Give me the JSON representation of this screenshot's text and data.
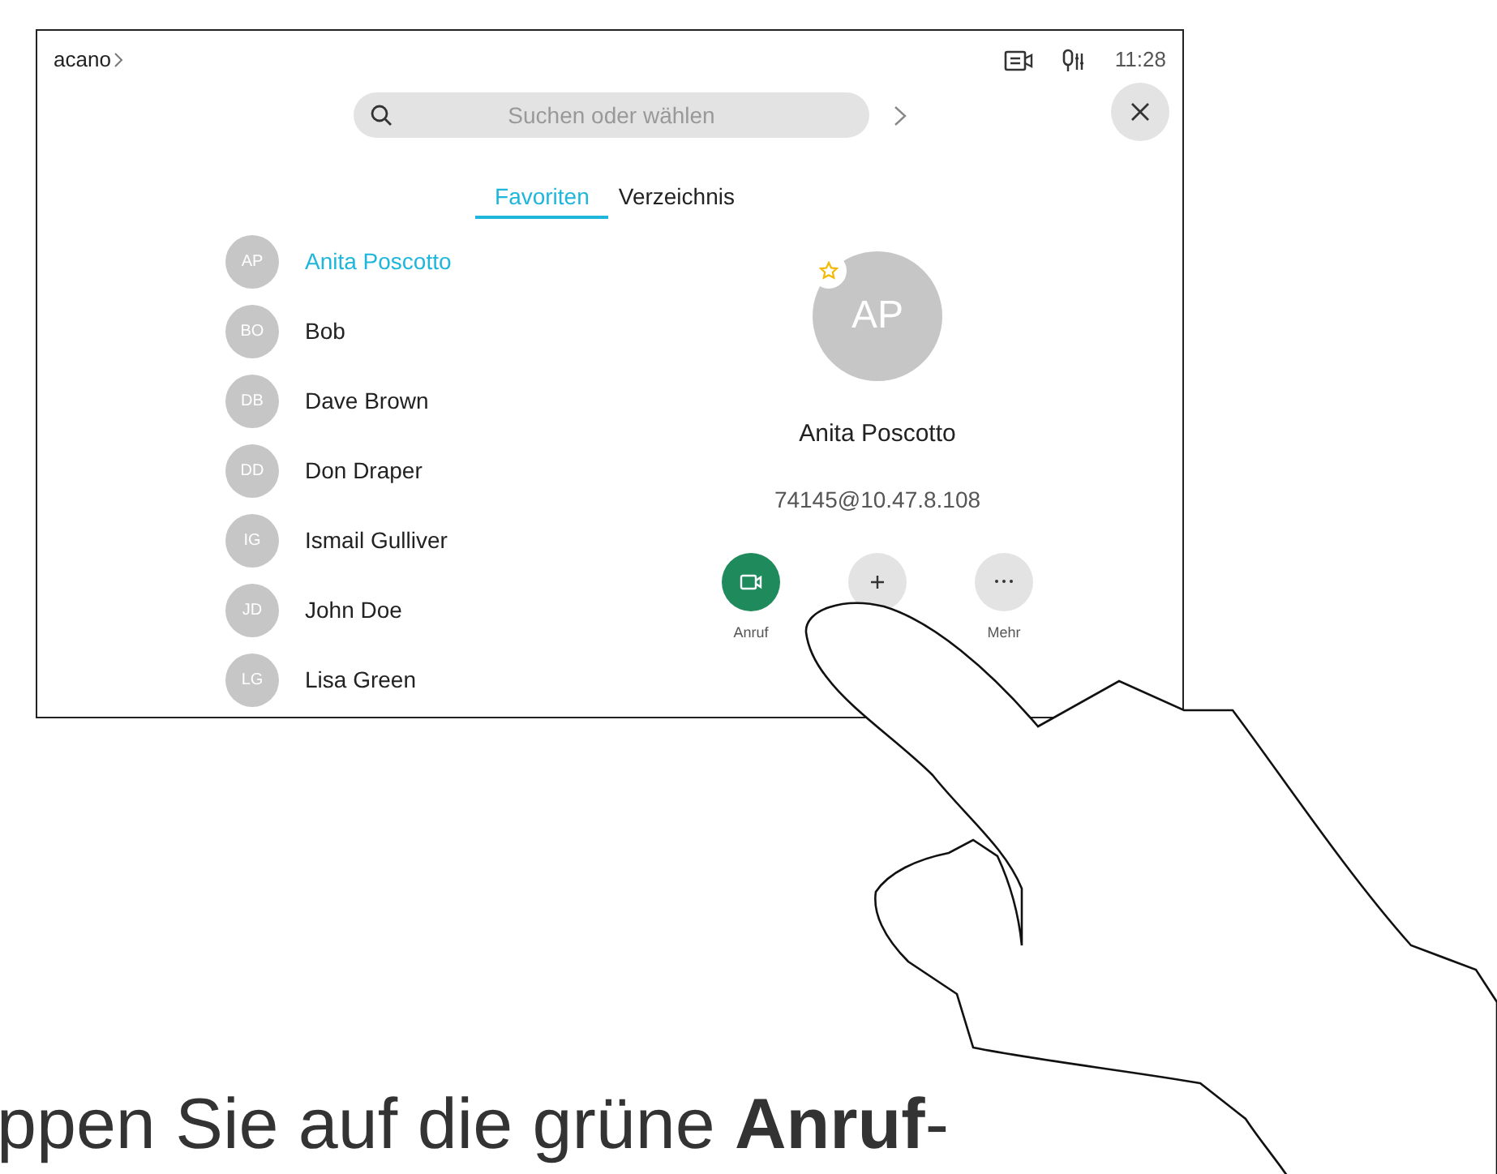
{
  "status_bar": {
    "breadcrumb": "acano",
    "time": "11:28"
  },
  "search": {
    "placeholder": "Suchen oder wählen"
  },
  "tabs": [
    {
      "label": "Favoriten",
      "selected": true
    },
    {
      "label": "Verzeichnis",
      "selected": false
    }
  ],
  "contacts": [
    {
      "initials": "AP",
      "name": "Anita Poscotto",
      "selected": true
    },
    {
      "initials": "BO",
      "name": "Bob",
      "selected": false
    },
    {
      "initials": "DB",
      "name": "Dave Brown",
      "selected": false
    },
    {
      "initials": "DD",
      "name": "Don Draper",
      "selected": false
    },
    {
      "initials": "IG",
      "name": "Ismail Gulliver",
      "selected": false
    },
    {
      "initials": "JD",
      "name": "John Doe",
      "selected": false
    },
    {
      "initials": "LG",
      "name": "Lisa Green",
      "selected": false
    }
  ],
  "detail": {
    "initials": "AP",
    "favorite": true,
    "name": "Anita Poscotto",
    "address": "74145@10.47.8.108",
    "actions": [
      {
        "kind": "call",
        "label": "Anruf"
      },
      {
        "kind": "add"
      },
      {
        "kind": "more",
        "label": "Mehr"
      }
    ]
  },
  "instruction": "ppen Sie auf die grüne **Anruf**-"
}
